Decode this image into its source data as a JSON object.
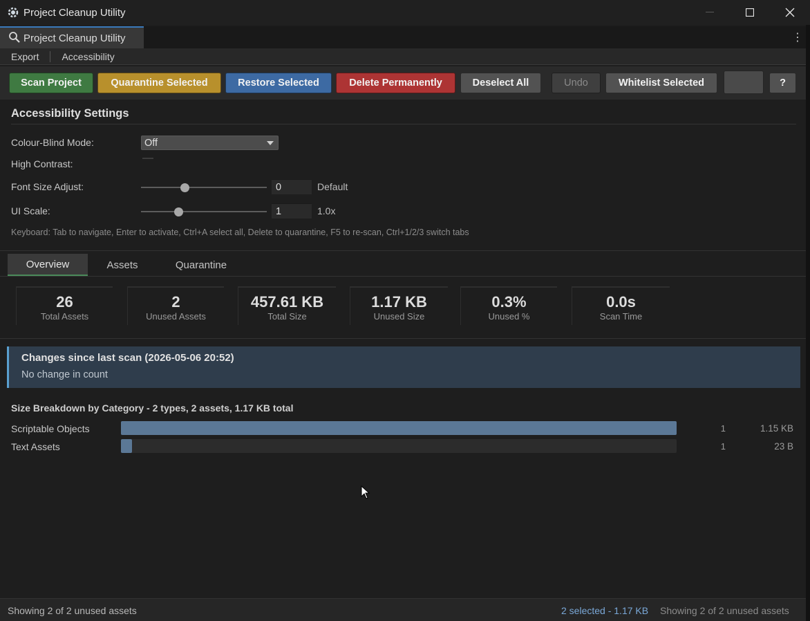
{
  "window": {
    "title": "Project Cleanup Utility",
    "tab_label": "Project Cleanup Utility"
  },
  "menu": {
    "export": "Export",
    "accessibility": "Accessibility"
  },
  "toolbar": {
    "scan": "Scan Project",
    "quarantine": "Quarantine Selected",
    "restore": "Restore Selected",
    "delete": "Delete Permanently",
    "deselect": "Deselect All",
    "undo": "Undo",
    "whitelist": "Whitelist Selected",
    "help": "?"
  },
  "accessibility": {
    "title": "Accessibility Settings",
    "colour_blind_label": "Colour-Blind Mode:",
    "colour_blind_value": "Off",
    "high_contrast_label": "High Contrast:",
    "font_size_label": "Font Size Adjust:",
    "font_size_value": "0",
    "font_size_suffix": "Default",
    "font_size_level": 0.35,
    "ui_scale_label": "UI Scale:",
    "ui_scale_value": "1",
    "ui_scale_suffix": "1.0x",
    "ui_scale_level": 0.3,
    "keyboard_hint": "Keyboard: Tab to navigate, Enter to activate, Ctrl+A select all, Delete to quarantine, F5 to re-scan, Ctrl+1/2/3 switch tabs"
  },
  "tabs": {
    "overview": "Overview",
    "assets": "Assets",
    "quarantine": "Quarantine"
  },
  "stats": [
    {
      "value": "26",
      "label": "Total Assets"
    },
    {
      "value": "2",
      "label": "Unused Assets"
    },
    {
      "value": "457.61 KB",
      "label": "Total Size"
    },
    {
      "value": "1.17 KB",
      "label": "Unused Size"
    },
    {
      "value": "0.3%",
      "label": "Unused %"
    },
    {
      "value": "0.0s",
      "label": "Scan Time"
    }
  ],
  "changes": {
    "heading": "Changes since last scan (2026-05-06 20:52)",
    "detail": "No change in count"
  },
  "breakdown": {
    "title": "Size Breakdown by Category - 2 types, 2 assets, 1.17 KB total",
    "rows": [
      {
        "name": "Scriptable Objects",
        "count": "1",
        "size": "1.15 KB",
        "fraction": 1.0
      },
      {
        "name": "Text Assets",
        "count": "1",
        "size": "23 B",
        "fraction": 0.02
      }
    ]
  },
  "status": {
    "left": "Showing 2 of 2 unused assets",
    "selection": "2 selected - 1.17 KB",
    "right": "Showing 2 of 2 unused assets"
  },
  "colors": {
    "scan": "#3f7a42",
    "quarantine": "#b8902c",
    "restore": "#3d6aa3",
    "delete": "#ad3434",
    "bar_fill": "#5b7896",
    "changes_accent": "#5aa0d0"
  }
}
